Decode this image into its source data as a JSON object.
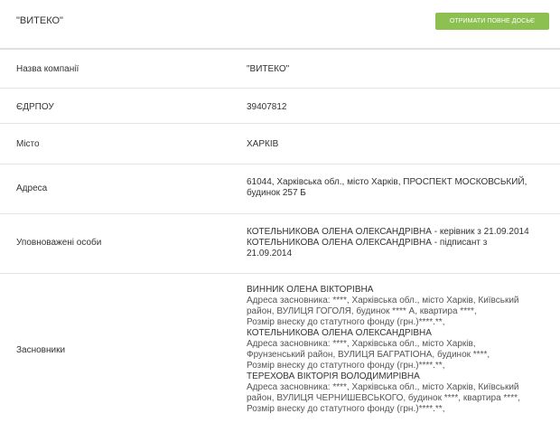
{
  "header": {
    "company_name": "\"ВИТЕКО\"",
    "dossier_button": "ОТРИМАТИ ПОВНЕ ДОСЬЄ"
  },
  "rows": {
    "name": {
      "label": "Назва компанії",
      "value": "\"ВИТЕКО\""
    },
    "edrpou": {
      "label": "ЄДРПОУ",
      "value": "39407812"
    },
    "city": {
      "label": "Місто",
      "value": "ХАРКІВ"
    },
    "address": {
      "label": "Адреса",
      "lines": [
        "61044, Харківська обл., місто Харків, ПРОСПЕКТ МОСКОВСЬКИЙ,",
        "будинок 257 Б"
      ]
    },
    "authorized": {
      "label": "Уповноважені особи",
      "lines": [
        "КОТЕЛЬНИКОВА ОЛЕНА ОЛЕКСАНДРІВНА - керівник з 21.09.2014",
        "КОТЕЛЬНИКОВА ОЛЕНА ОЛЕКСАНДРІВНА - підписант з",
        "21.09.2014"
      ]
    },
    "founders": {
      "label": "Засновники",
      "people": [
        {
          "name": "ВИННИК ОЛЕНА ВІКТОРІВНА",
          "details": [
            "Адреса засновника: ****, Харківська обл., місто Харків, Київський",
            "район, ВУЛИЦЯ ГОГОЛЯ, будинок **** А, квартира ****,",
            "Розмір внеску до статутного фонду (грн.)****.**,"
          ]
        },
        {
          "name": "КОТЕЛЬНИКОВА ОЛЕНА ОЛЕКСАНДРІВНА",
          "details": [
            "Адреса засновника: ****, Харківська обл., місто Харків,",
            "Фрунзенський район, ВУЛИЦЯ БАГРАТІОНА, будинок ****,",
            "Розмір внеску до статутного фонду (грн.)****.**,"
          ]
        },
        {
          "name": "ТЕРЕХОВА ВІКТОРІЯ ВОЛОДИМИРІВНА",
          "details": [
            "Адреса засновника: ****, Харківська обл., місто Харків, Київський",
            "район, ВУЛИЦЯ ЧЕРНИШЕВСЬКОГО, будинок ****, квартира ****,",
            "Розмір внеску до статутного фонду (грн.)****.**,"
          ]
        }
      ]
    }
  },
  "colors": {
    "button_bg": "#8cc152",
    "divider": "#e4e4e4",
    "text": "#333333"
  }
}
